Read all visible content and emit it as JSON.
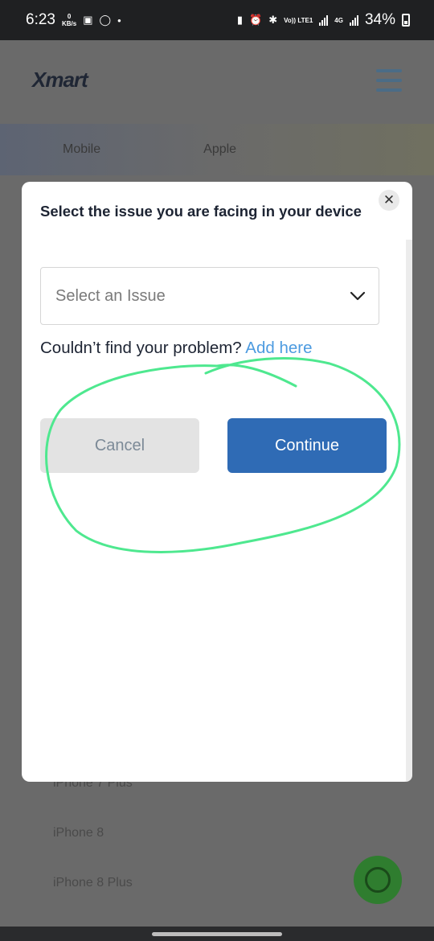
{
  "status_bar": {
    "time": "6:23",
    "kbs_value": "0",
    "kbs_unit": "KB/s",
    "volte_label": "Vo)) LTE1",
    "network_label": "4G",
    "battery_percent": "34%"
  },
  "background": {
    "logo_text": "Xmart",
    "tabs": [
      "Mobile",
      "Apple"
    ],
    "list_items": [
      "iPhone 7 Plus",
      "iPhone 8",
      "iPhone 8 Plus"
    ]
  },
  "modal": {
    "title": "Select the issue you are facing in your device",
    "close_symbol": "✕",
    "select_placeholder": "Select an Issue",
    "help_text": "Couldn’t find your problem?",
    "help_link": "Add here",
    "cancel_label": "Cancel",
    "continue_label": "Continue"
  },
  "colors": {
    "primary": "#2f6bb5",
    "link": "#4d9be0",
    "annotation": "#4ee88f"
  }
}
